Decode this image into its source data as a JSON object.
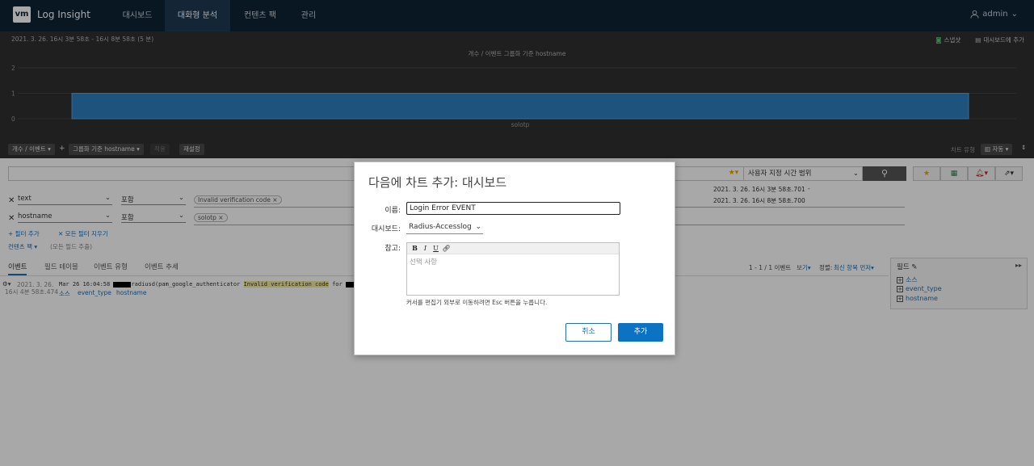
{
  "nav": {
    "logo": "vm",
    "app_title": "Log Insight",
    "tabs": [
      "대시보드",
      "대화형 분석",
      "컨텐츠 팩",
      "관리"
    ],
    "user": "admin"
  },
  "chart_header": {
    "range": "2021. 3. 26.  16시 3분 58초 - 16시 8분 58초   (5 분)",
    "snapshot": "스냅샷",
    "add_dashboard": "대시보드에 추가"
  },
  "chart_data": {
    "type": "bar",
    "title": "개수 / 이벤트 그룹화 기준 hostname",
    "categories": [
      "solotp"
    ],
    "values": [
      1
    ],
    "ylim": [
      0,
      2
    ],
    "yticks": [
      "0",
      "1",
      "2"
    ],
    "grid": true,
    "bar_color": "#2e7fc0"
  },
  "chart_toolbar": {
    "count_select": "개수 / 이벤트",
    "plus": "+",
    "group_select": "그룹화 기준 hostname",
    "apply": "적용",
    "reset": "재설정",
    "chart_type_label": "차트 유형",
    "chart_type_value": "자동"
  },
  "query": {
    "time_range": "사용자 지정 시간 범위",
    "time_from": "2021. 3. 26.  16시 3분 58초.701",
    "time_to": "2021. 3. 26.  16시 8분 58초.700"
  },
  "filters": [
    {
      "field": "text",
      "op": "포함",
      "value": "Invalid verification code"
    },
    {
      "field": "hostname",
      "op": "포함",
      "value": "solotp"
    }
  ],
  "filter_actions": {
    "add": "+ 필터 추가",
    "clear": "✕ 모든 필터 지우기",
    "content_pack": "컨텐츠 팩",
    "all_fields": "(모든 필드 추출)"
  },
  "results": {
    "tabs": [
      "이벤트",
      "필드 테이블",
      "이벤트 유형",
      "이벤트 추세"
    ],
    "count": "1 - 1 / 1 이벤트",
    "view": "보기",
    "sort_label": "정렬:",
    "sort_value": "최신 항목 먼저",
    "event": {
      "date": "2021. 3. 26.",
      "time": "16시 4분 58초.474",
      "prefix": "Mar 26 16:04:58",
      "body": "radiusd(pam_google_authenticator",
      "highlight": "Invalid verification code",
      "suffix": "for",
      "tags": [
        "소스",
        "event_type",
        "hostname"
      ]
    }
  },
  "fields_panel": {
    "title": "필드",
    "items": [
      "소스",
      "event_type",
      "hostname"
    ]
  },
  "dialog": {
    "title": "다음에 차트 추가: 대시보드",
    "name_label": "이름:",
    "name_value": "Login Error EVENT",
    "dashboard_label": "대시보드:",
    "dashboard_value": "Radius-Accesslog",
    "note_label": "참고:",
    "note_placeholder": "선택 사항",
    "help": "커서를 편집기 외부로 이동하려면 Esc 버튼을 누릅니다.",
    "cancel": "취소",
    "add": "추가",
    "toolbar": [
      "B",
      "I",
      "U"
    ]
  }
}
